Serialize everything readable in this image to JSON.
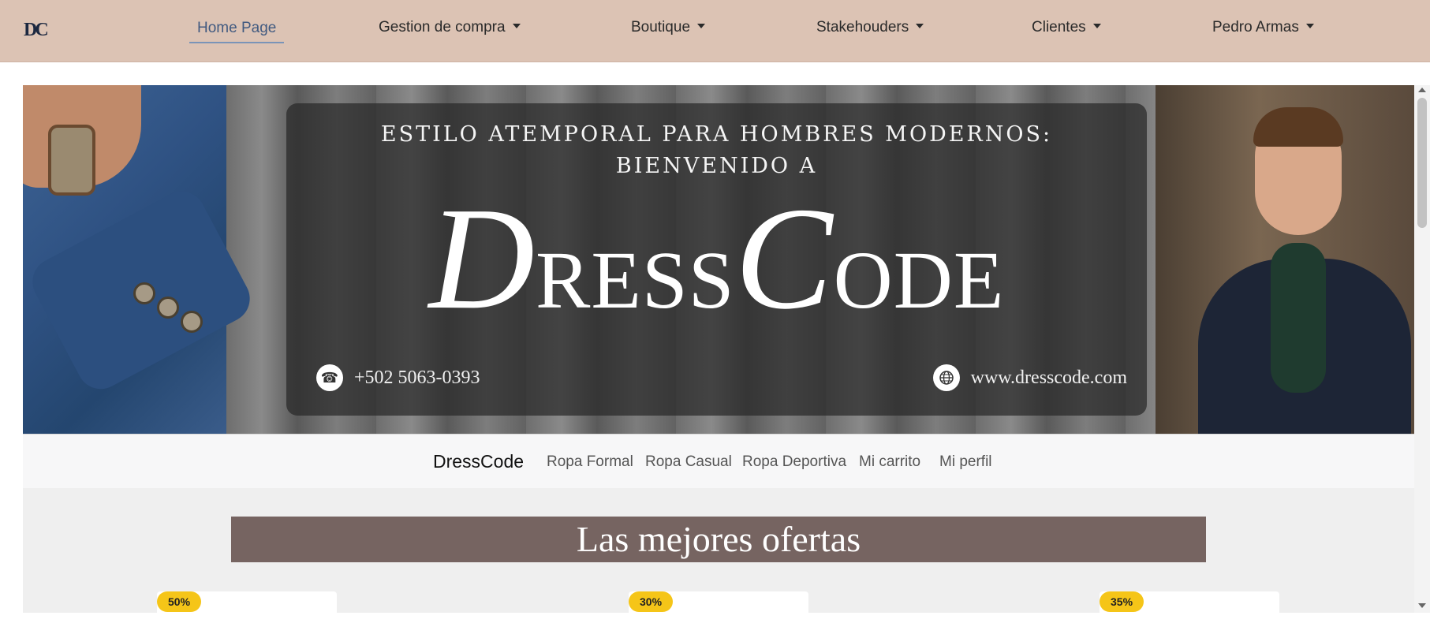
{
  "topnav": {
    "logo": "DC",
    "items": [
      {
        "label": "Home Page",
        "dropdown": false,
        "active": true
      },
      {
        "label": "Gestion de compra",
        "dropdown": true
      },
      {
        "label": "Boutique",
        "dropdown": true
      },
      {
        "label": "Stakehouders",
        "dropdown": true
      },
      {
        "label": "Clientes",
        "dropdown": true
      },
      {
        "label": "Pedro Armas",
        "dropdown": true
      }
    ]
  },
  "hero": {
    "tagline_1": "ESTILO ATEMPORAL PARA HOMBRES MODERNOS:",
    "tagline_2": "BIENVENIDO A",
    "brand_d": "D",
    "brand_ress": "RESS",
    "brand_c": "C",
    "brand_ode": "ODE",
    "phone": "+502 5063-0393",
    "website": "www.dresscode.com",
    "phone_icon": "phone-icon",
    "web_icon": "globe-icon"
  },
  "subnav": {
    "brand": "DressCode",
    "links": [
      "Ropa Formal",
      "Ropa Casual",
      "Ropa Deportiva",
      "Mi carrito",
      "Mi perfil"
    ]
  },
  "offers": {
    "title": "Las mejores ofertas",
    "badges": [
      "50%",
      "30%",
      "35%"
    ]
  },
  "colors": {
    "navbar_bg": "#dcc3b4",
    "active_link": "#415a80",
    "offers_title_bg": "#766461",
    "badge": "#f5c518"
  }
}
